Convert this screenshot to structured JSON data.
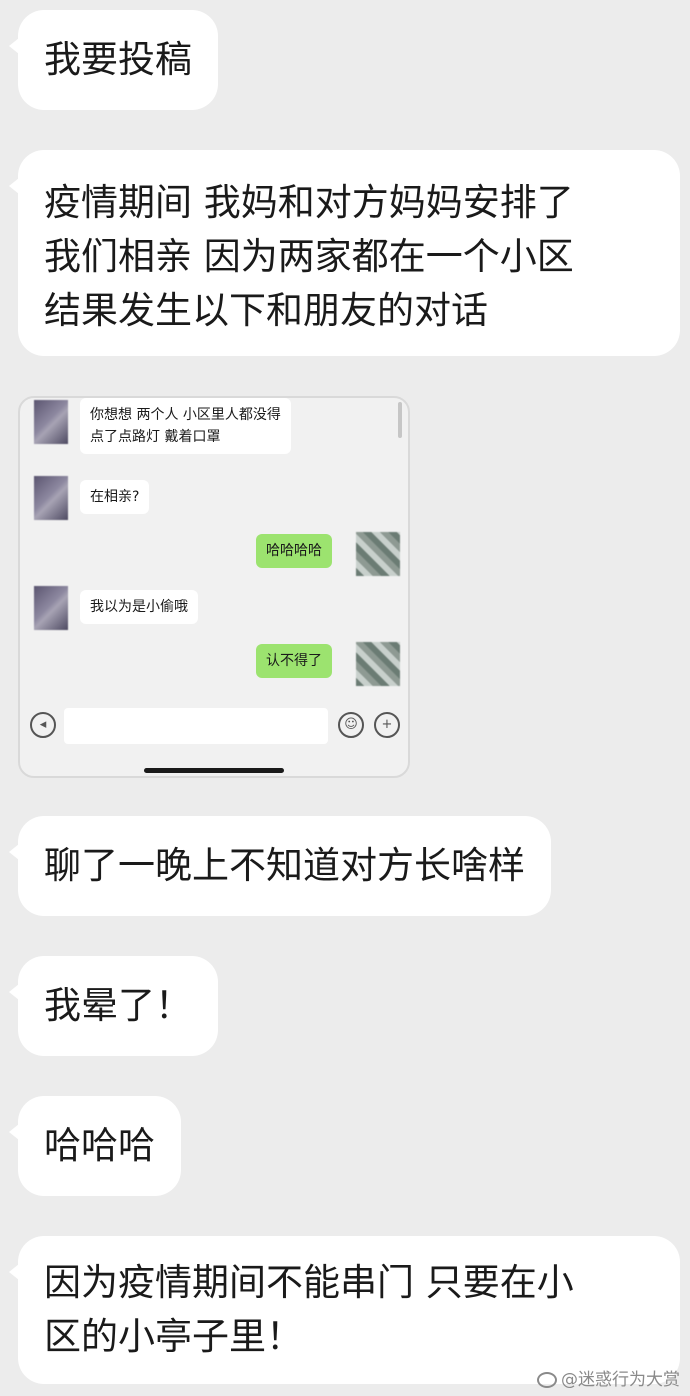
{
  "messages": {
    "m1": "我要投稿",
    "m2_lines": [
      "疫情期间 我妈和对方妈妈安排了",
      "我们相亲 因为两家都在一个小区",
      "结果发生以下和朋友的对话"
    ],
    "m3": "聊了一晚上不知道对方长啥样",
    "m4": "我晕了！",
    "m5": "哈哈哈",
    "m6_lines": [
      "因为疫情期间不能串门 只要在小",
      "区的小亭子里！"
    ]
  },
  "embedded_chat": {
    "messages": [
      {
        "side": "left",
        "lines": [
          "你想想 两个人 小区里人都没得",
          "点了点路灯 戴着口罩"
        ]
      },
      {
        "side": "left",
        "lines": [
          "在相亲?"
        ]
      },
      {
        "side": "right",
        "lines": [
          "哈哈哈哈"
        ]
      },
      {
        "side": "left",
        "lines": [
          "我以为是小偷哦"
        ]
      },
      {
        "side": "right",
        "lines": [
          "认不得了"
        ]
      }
    ],
    "input": {
      "value": ""
    },
    "icons": {
      "voice": "voice-icon",
      "emoji": "emoji-icon",
      "plus": "plus-icon"
    },
    "colors": {
      "incoming": "#ffffff",
      "outgoing": "#9ce36f"
    }
  },
  "watermark": "@迷惑行为大赏",
  "colors": {
    "background": "#ececec",
    "bubble": "#ffffff"
  }
}
